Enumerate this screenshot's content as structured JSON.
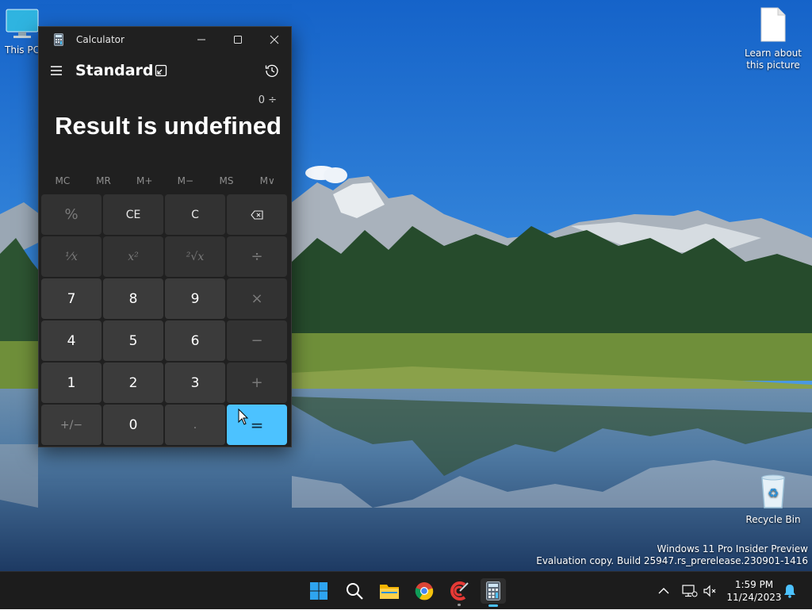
{
  "desktop": {
    "icons": {
      "this_pc": "This PC",
      "learn": "Learn about this picture",
      "recycle": "Recycle Bin"
    },
    "watermark": {
      "line1": "Windows 11 Pro Insider Preview",
      "line2": "Evaluation copy. Build 25947.rs_prerelease.230901-1416"
    }
  },
  "calculator": {
    "window_title": "Calculator",
    "mode": "Standard",
    "expression": "0 ÷",
    "result": "Result is undefined",
    "memory": [
      "MC",
      "MR",
      "M+",
      "M−",
      "MS",
      "M∨"
    ],
    "keys": {
      "percent": "%",
      "ce": "CE",
      "c": "C",
      "backspace": "⌫",
      "reciprocal": "⅟x",
      "square": "x²",
      "sqrt": "²√x",
      "divide": "÷",
      "k7": "7",
      "k8": "8",
      "k9": "9",
      "multiply": "×",
      "k4": "4",
      "k5": "5",
      "k6": "6",
      "minus": "−",
      "k1": "1",
      "k2": "2",
      "k3": "3",
      "plus": "+",
      "negate": "+/−",
      "k0": "0",
      "decimal": ".",
      "equals": "="
    },
    "colors": {
      "accent": "#4cc2ff",
      "window_bg": "#202020"
    }
  },
  "taskbar": {
    "clock_time": "1:59 PM",
    "clock_date": "11/24/2023",
    "apps": [
      "start-icon",
      "search-icon",
      "file-explorer-icon",
      "chrome-icon",
      "ccleaner-icon",
      "calculator-icon"
    ]
  }
}
